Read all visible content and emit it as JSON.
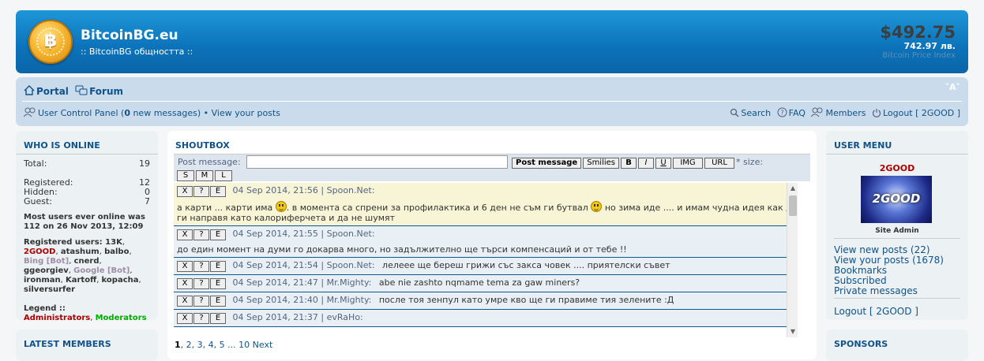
{
  "header": {
    "logo_glyph": "฿",
    "title": "BitcoinBG.eu",
    "description": ":: BitcoinBG общността ::",
    "price_usd": "$492.75",
    "price_lv": "742.97 лв.",
    "price_index_label": "Bitcoin Price Index"
  },
  "nav": {
    "portal": "Portal",
    "forum": "Forum",
    "font_size": "˅A˄",
    "ucp_label": "User Control Panel",
    "ucp_open": "(",
    "new_messages_count": "0",
    "new_messages_label": " new messages)",
    "bullet": " • ",
    "view_posts": "View your posts",
    "search": "Search",
    "faq": "FAQ",
    "members": "Members",
    "logout": "Logout [ 2GOOD ]"
  },
  "who_online": {
    "title": "WHO IS ONLINE",
    "total_label": "Total:",
    "total": "19",
    "registered_label": "Registered:",
    "registered": "12",
    "hidden_label": "Hidden:",
    "hidden": "0",
    "guest_label": "Guest:",
    "guest": "7",
    "most_users": "Most users ever online was 112 on 26 Nov 2013, 12:09",
    "registered_users_label": "Registered users: ",
    "users": [
      {
        "name": "13K",
        "type": "normal"
      },
      {
        "name": "2GOOD",
        "type": "admin"
      },
      {
        "name": "atashum",
        "type": "normal"
      },
      {
        "name": "balbo",
        "type": "normal"
      },
      {
        "name": "Bing [Bot]",
        "type": "bot"
      },
      {
        "name": "cnerd",
        "type": "normal"
      },
      {
        "name": "ggeorgiev",
        "type": "normal"
      },
      {
        "name": "Google [Bot]",
        "type": "bot"
      },
      {
        "name": "ironman",
        "type": "normal"
      },
      {
        "name": "Kartoff",
        "type": "normal"
      },
      {
        "name": "kopacha",
        "type": "normal"
      },
      {
        "name": "silversurfer",
        "type": "normal"
      }
    ],
    "legend_label": "Legend :: ",
    "legend_admins": "Administrators",
    "legend_comma": ", ",
    "legend_mods": "Moderators"
  },
  "latest_members": {
    "title": "LATEST MEMBERS"
  },
  "shoutbox": {
    "title": "SHOUTBOX",
    "post_label": "Post message:",
    "post_placeholder": "",
    "post_button": "Post message",
    "smilies": "Smilies",
    "bold": "B",
    "italic": "I",
    "underline": "U",
    "img": "IMG",
    "url": "URL",
    "size_label": "* size:",
    "size_s": "S",
    "size_m": "M",
    "size_l": "L",
    "btn_x": "X",
    "btn_q": "?",
    "btn_e": "E",
    "messages": [
      {
        "date": "04 Sep 2014, 21:56",
        "author": "Spoon.Net:",
        "part1": "а карти ... карти има ",
        "part2": ". в момента са спрени за профилактика и 6 ден не съм ги бутвал ",
        "part3": " но зима иде .... и имам чудна идея как да ги направя като калориферчета и да не шумят"
      },
      {
        "date": "04 Sep 2014, 21:55",
        "author": "Spoon.Net:",
        "body": "до един момент на думи го докарва много, но задължително ще търси компенсаций и от тебе !!"
      },
      {
        "date": "04 Sep 2014, 21:54",
        "author": "Spoon.Net:",
        "text": "лелеее ще береш грижи със закса човек .... приятелски съвет"
      },
      {
        "date": "04 Sep 2014, 21:47",
        "author": "Mr.Mighty:",
        "text": "abe nie zashto nqmame tema za gaw miners?"
      },
      {
        "date": "04 Sep 2014, 21:40",
        "author": "Mr.Mighty:",
        "text": "после тоя зенпул като умре кво ще ги правиме тия зелените :Д"
      },
      {
        "date": "04 Sep 2014, 21:37",
        "author": "evRaHo:",
        "text": ""
      }
    ],
    "pager": {
      "current": "1",
      "pages": [
        ", ",
        "2",
        ", ",
        "3",
        ", ",
        "4",
        ", ",
        "5",
        " ... ",
        "10",
        " ",
        "Next"
      ]
    }
  },
  "user_menu": {
    "title": "USER MENU",
    "username": "2GOOD",
    "avatar_text": "2GOOD",
    "rank": "Site Admin",
    "view_new_posts": "View new posts (22)",
    "view_your_posts": "View your posts (1678)",
    "bookmarks": "Bookmarks",
    "subscribed": "Subscribed",
    "private_messages": "Private messages",
    "logout": "Logout [ 2GOOD ]"
  },
  "sponsors": {
    "title": "SPONSORS"
  }
}
